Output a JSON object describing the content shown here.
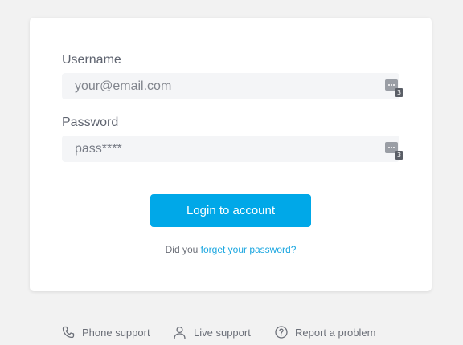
{
  "login": {
    "username_label": "Username",
    "username_placeholder": "your@email.com",
    "password_label": "Password",
    "password_value": "pass****",
    "manager_badge_count": "3",
    "login_button": "Login to account",
    "forgot_prefix": "Did you",
    "forgot_link": "forget your password?"
  },
  "footer": {
    "phone_support": "Phone support",
    "live_support": "Live support",
    "report_problem": "Report a problem"
  },
  "colors": {
    "accent": "#00a8e8",
    "background": "#f2f2f2",
    "card": "#ffffff",
    "field": "#f4f5f7"
  },
  "icons": {
    "password_manager": "password-manager-icon",
    "phone": "phone-icon",
    "person": "person-icon",
    "help": "help-circle-icon"
  }
}
